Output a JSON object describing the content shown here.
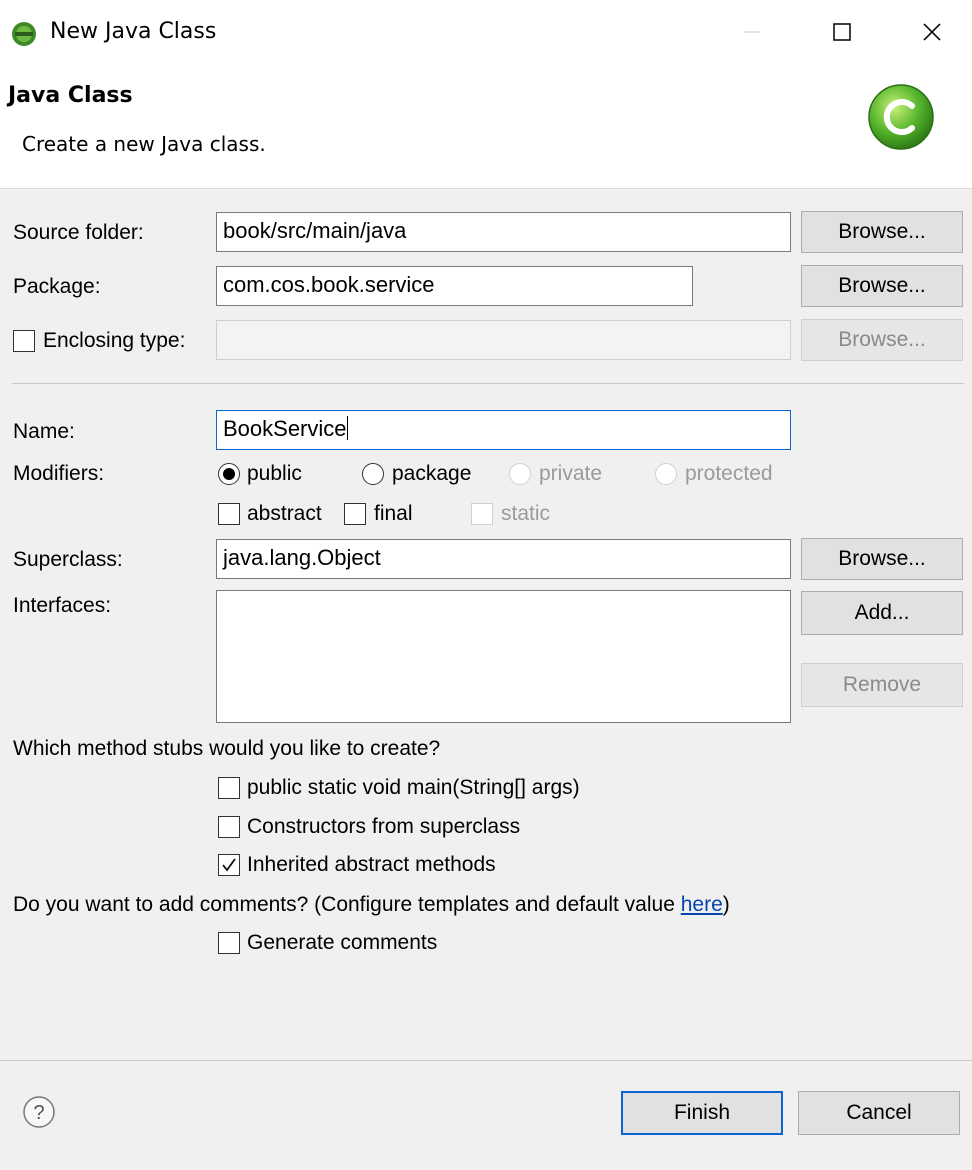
{
  "window": {
    "title": "New Java Class",
    "app_icon": "eclipse-icon",
    "controls": [
      "minimize-icon",
      "maximize-icon",
      "close-icon"
    ]
  },
  "header": {
    "title": "Java Class",
    "description": "Create a new Java class.",
    "icon": "java-class-c-icon"
  },
  "form": {
    "source_folder": {
      "label": "Source folder:",
      "value": "book/src/main/java",
      "browse": "Browse..."
    },
    "package": {
      "label": "Package:",
      "value": "com.cos.book.service",
      "browse": "Browse..."
    },
    "enclosing_type": {
      "label": "Enclosing type:",
      "checked": false,
      "value": "",
      "browse": "Browse..."
    },
    "name": {
      "label": "Name:",
      "value": "BookService"
    },
    "modifiers": {
      "label": "Modifiers:",
      "options": [
        {
          "label": "public",
          "selected": true,
          "enabled": true
        },
        {
          "label": "package",
          "selected": false,
          "enabled": true
        },
        {
          "label": "private",
          "selected": false,
          "enabled": false
        },
        {
          "label": "protected",
          "selected": false,
          "enabled": false
        }
      ],
      "checks": [
        {
          "label": "abstract",
          "checked": false,
          "enabled": true
        },
        {
          "label": "final",
          "checked": false,
          "enabled": true
        },
        {
          "label": "static",
          "checked": false,
          "enabled": false
        }
      ]
    },
    "superclass": {
      "label": "Superclass:",
      "value": "java.lang.Object",
      "browse": "Browse..."
    },
    "interfaces": {
      "label": "Interfaces:",
      "add": "Add...",
      "remove": "Remove"
    }
  },
  "stubs": {
    "question": "Which method stubs would you like to create?",
    "options": [
      {
        "label": "public static void main(String[] args)",
        "checked": false
      },
      {
        "label": "Constructors from superclass",
        "checked": false
      },
      {
        "label": "Inherited abstract methods",
        "checked": true
      }
    ]
  },
  "comments": {
    "question": "Do you want to add comments? (Configure templates and default value ",
    "link": "here",
    "close_paren": ")",
    "option": {
      "label": "Generate comments",
      "checked": false
    }
  },
  "footer": {
    "help_icon": "help-icon",
    "finish": "Finish",
    "cancel": "Cancel"
  }
}
